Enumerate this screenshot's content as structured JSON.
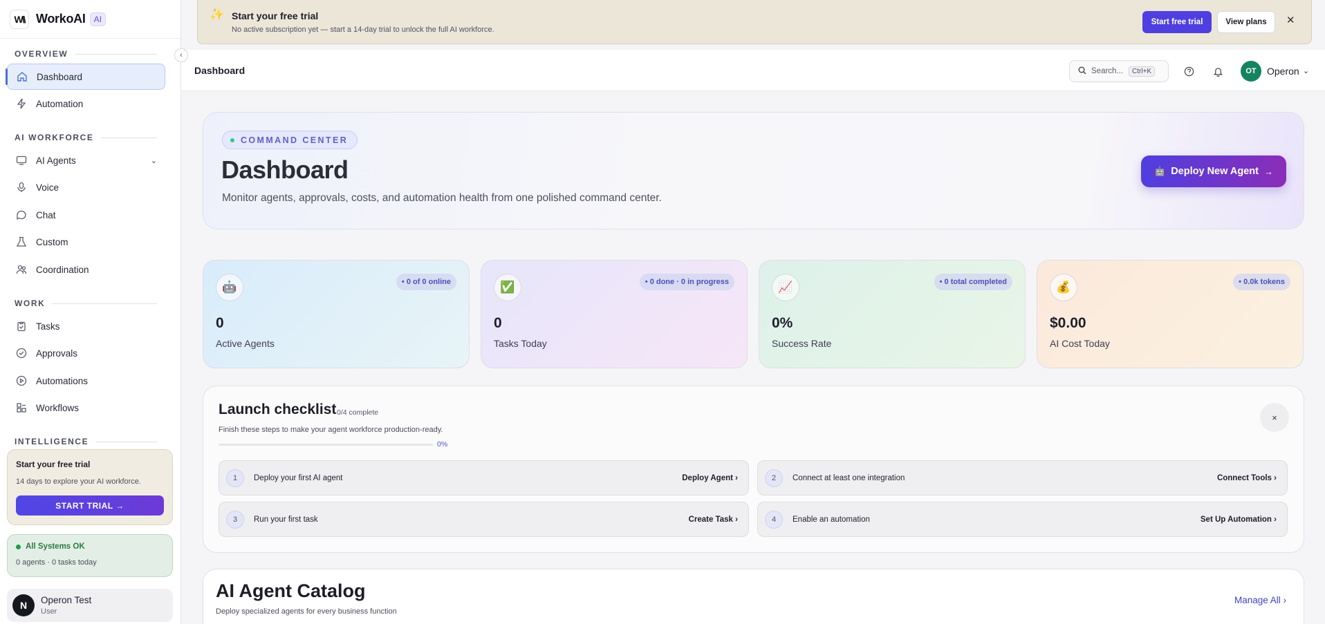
{
  "brand": {
    "logo": "W\\\\",
    "name": "WorkoAI",
    "badge": "AI"
  },
  "sidebar": {
    "sections": {
      "overview": "OVERVIEW",
      "ai_workforce": "AI WORKFORCE",
      "work": "WORK",
      "intelligence": "INTELLIGENCE"
    },
    "items": {
      "dashboard": "Dashboard",
      "automation": "Automation",
      "ai_agents": "AI Agents",
      "voice": "Voice",
      "chat": "Chat",
      "custom": "Custom",
      "coordination": "Coordination",
      "tasks": "Tasks",
      "approvals": "Approvals",
      "automations": "Automations",
      "workflows": "Workflows"
    },
    "trial": {
      "title": "Start your free trial",
      "subtitle": "14 days to explore your AI workforce.",
      "button": "START TRIAL →"
    },
    "status": {
      "title": "All Systems OK",
      "detail": "0 agents · 0 tasks today",
      "color": "#1f9d4c"
    },
    "user": {
      "initial": "N",
      "name": "Operon Test",
      "role": "User"
    }
  },
  "banner": {
    "title": "Start your free trial",
    "subtitle": "No active subscription yet — start a 14-day trial to unlock the full AI workforce.",
    "primary": "Start free trial",
    "secondary": "View plans",
    "close": "✕"
  },
  "header": {
    "title": "Dashboard",
    "search_placeholder": "Search...",
    "shortcut": "Ctrl+K",
    "avatar": "OT",
    "user": "Operon"
  },
  "hero": {
    "pill": "COMMAND CENTER",
    "title": "Dashboard",
    "subtitle": "Monitor agents, approvals, costs, and automation health from one polished command center.",
    "button": "Deploy New Agent"
  },
  "kpis": [
    {
      "icon": "🤖",
      "badge": "• 0 of 0 online",
      "value": "0",
      "label": "Active Agents"
    },
    {
      "icon": "✅",
      "badge": "• 0 done · 0 in progress",
      "value": "0",
      "label": "Tasks Today"
    },
    {
      "icon": "📈",
      "badge": "• 0 total completed",
      "value": "0%",
      "label": "Success Rate"
    },
    {
      "icon": "💰",
      "badge": "• 0.0k tokens",
      "value": "$0.00",
      "label": "AI Cost Today"
    }
  ],
  "checklist": {
    "title": "Launch checklist",
    "count": "0/4 complete",
    "subtitle": "Finish these steps to make your agent workforce production-ready.",
    "percent": "0%",
    "progress": 0,
    "close": "×",
    "steps": [
      {
        "num": "1",
        "text": "Deploy your first AI agent",
        "action": "Deploy Agent"
      },
      {
        "num": "2",
        "text": "Connect at least one integration",
        "action": "Connect Tools"
      },
      {
        "num": "3",
        "text": "Run your first task",
        "action": "Create Task"
      },
      {
        "num": "4",
        "text": "Enable an automation",
        "action": "Set Up Automation"
      }
    ]
  },
  "catalog": {
    "title": "AI Agent Catalog",
    "subtitle": "Deploy specialized agents for every business function",
    "link": "Manage All"
  }
}
